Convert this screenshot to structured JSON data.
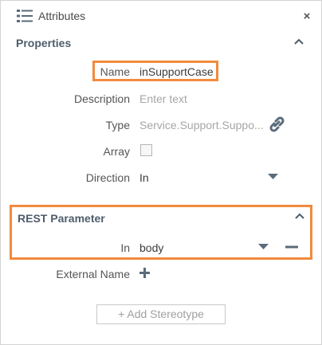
{
  "header": {
    "title": "Attributes",
    "close_glyph": "×",
    "list_icon": "list-icon",
    "close_icon": "close-icon"
  },
  "properties": {
    "section_title": "Properties",
    "collapse_icon": "chevron-up-icon",
    "name_label": "Name",
    "name_value": "inSupportCase",
    "description_label": "Description",
    "description_placeholder": "Enter text",
    "type_label": "Type",
    "type_value": "Service.Support.Suppo...",
    "type_link_icon": "link-icon",
    "array_label": "Array",
    "array_checked": false,
    "direction_label": "Direction",
    "direction_value": "In",
    "direction_dropdown_icon": "caret-down-icon"
  },
  "rest_parameter": {
    "section_title": "REST Parameter",
    "collapse_icon": "chevron-up-icon",
    "in_label": "In",
    "in_value": "body",
    "dropdown_icon": "caret-down-icon",
    "remove_icon": "minus-icon"
  },
  "external_name": {
    "label": "External Name",
    "add_icon": "plus-icon",
    "add_glyph": "+"
  },
  "stereotype": {
    "add_label": "+ Add Stereotype"
  },
  "colors": {
    "highlight": "#f28a3c",
    "section_heading": "#4e5d6c",
    "icon": "#5a6b7b"
  }
}
